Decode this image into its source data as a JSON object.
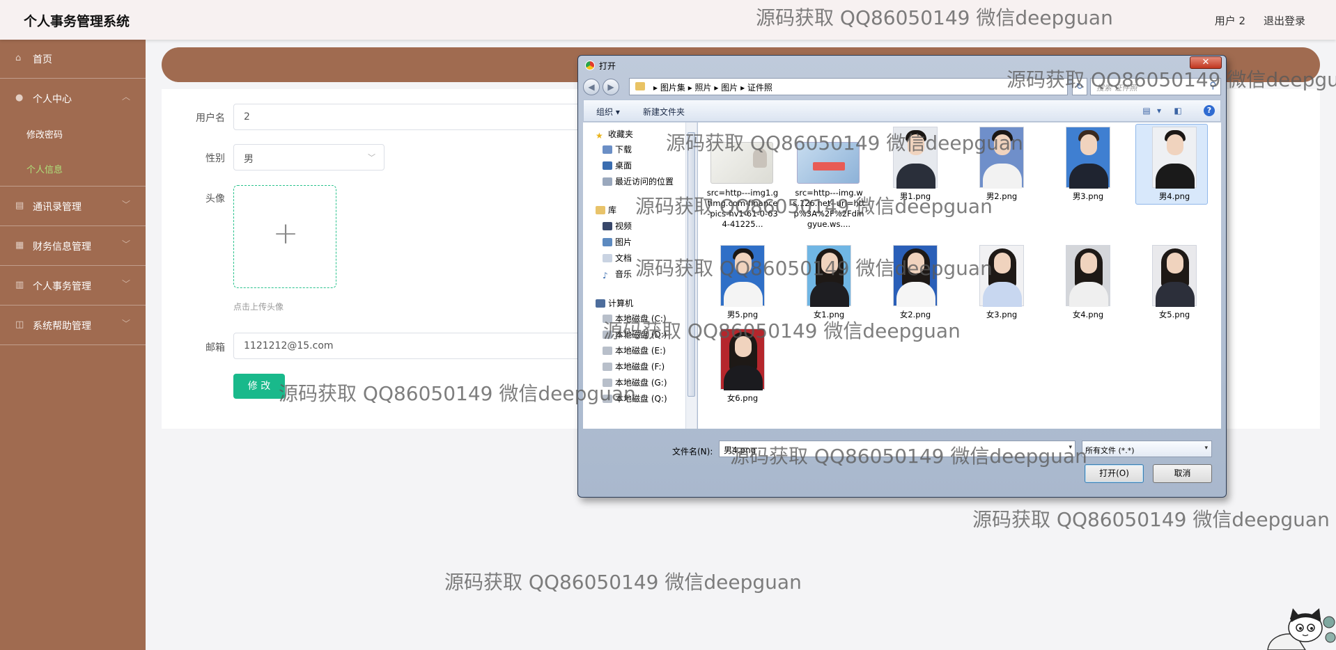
{
  "app": {
    "title": "个人事务管理系统",
    "user": "用户 2",
    "logout": "退出登录"
  },
  "sidebar": {
    "items": [
      {
        "label": "首页",
        "icon": "home-icon"
      },
      {
        "label": "个人中心",
        "icon": "user-icon",
        "expanded": true,
        "children": [
          {
            "label": "修改密码"
          },
          {
            "label": "个人信息",
            "active": true
          }
        ]
      },
      {
        "label": "通讯录管理",
        "icon": "contacts-icon"
      },
      {
        "label": "财务信息管理",
        "icon": "finance-icon"
      },
      {
        "label": "个人事务管理",
        "icon": "tasks-icon"
      },
      {
        "label": "系统帮助管理",
        "icon": "help-icon"
      }
    ]
  },
  "form": {
    "username_label": "用户名",
    "username_value": "2",
    "gender_label": "性别",
    "gender_value": "男",
    "avatar_label": "头像",
    "avatar_hint": "点击上传头像",
    "email_label": "邮箱",
    "email_value": "1121212@15.com",
    "submit_label": "修 改"
  },
  "dialog": {
    "title": "打开",
    "breadcrumb": [
      "图片集",
      "照片",
      "图片",
      "证件照"
    ],
    "search_placeholder": "搜索 证件照",
    "toolbar": {
      "organize": "组织 ▾",
      "new_folder": "新建文件夹"
    },
    "tree": {
      "favorites": "收藏夹",
      "downloads": "下载",
      "desktop": "桌面",
      "recent": "最近访问的位置",
      "libraries": "库",
      "videos": "视频",
      "pictures": "图片",
      "documents": "文档",
      "music": "音乐",
      "computer": "计算机",
      "drives": [
        "本地磁盘 (C:)",
        "本地磁盘 (D:)",
        "本地磁盘 (E:)",
        "本地磁盘 (F:)",
        "本地磁盘 (G:)",
        "本地磁盘 (Q:)"
      ]
    },
    "files": [
      {
        "name": "src=http---img1.gtimg.com-finance-pics-hv1-61-0-634-41225...",
        "kind": "id-card-a"
      },
      {
        "name": "src=http---img.ws.126.net--url=http%3A%2F%2Fdingyue.ws....",
        "kind": "id-card-b"
      },
      {
        "name": "男1.png",
        "kind": "male"
      },
      {
        "name": "男2.png",
        "kind": "male"
      },
      {
        "name": "男3.png",
        "kind": "male"
      },
      {
        "name": "男4.png",
        "kind": "male",
        "selected": true
      },
      {
        "name": "男5.png",
        "kind": "male"
      },
      {
        "name": "女1.png",
        "kind": "female"
      },
      {
        "name": "女2.png",
        "kind": "female"
      },
      {
        "name": "女3.png",
        "kind": "female"
      },
      {
        "name": "女4.png",
        "kind": "female"
      },
      {
        "name": "女5.png",
        "kind": "female"
      },
      {
        "name": "女6.png",
        "kind": "female"
      }
    ],
    "filename_label": "文件名(N):",
    "filename_value": "男4.png",
    "filetype_value": "所有文件 (*.*)",
    "open_label": "打开(O)",
    "cancel_label": "取消"
  },
  "watermark": "源码获取 QQ86050149 微信deepguan",
  "colors": {
    "sidebar": "#a06b50",
    "accent": "#19b98b",
    "active_sub": "#aee07a"
  }
}
